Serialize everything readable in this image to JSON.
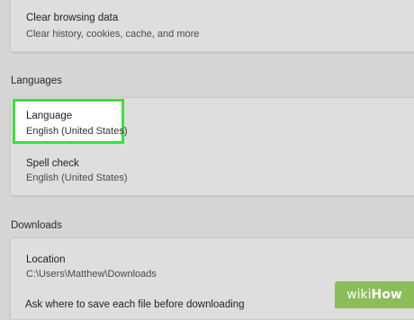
{
  "privacy": {
    "clear_title": "Clear browsing data",
    "clear_subtitle": "Clear history, cookies, cache, and more"
  },
  "languages": {
    "heading": "Languages",
    "language_title": "Language",
    "language_value": "English (United States)",
    "spellcheck_title": "Spell check",
    "spellcheck_value": "English (United States)"
  },
  "downloads": {
    "heading": "Downloads",
    "location_title": "Location",
    "location_value": "C:\\Users\\Matthew\\Downloads",
    "ask_partial": "Ask where to save each file before downloading"
  },
  "watermark": {
    "prefix": "wiki",
    "suffix": "How"
  },
  "colors": {
    "highlight_border": "#3be03b",
    "watermark_bg": "#8bbd5a"
  }
}
